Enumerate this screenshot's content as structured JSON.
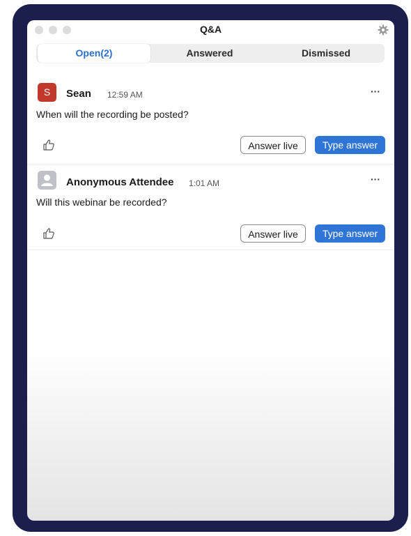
{
  "window": {
    "title": "Q&A"
  },
  "tabs": [
    {
      "label": "Open(2)",
      "active": true
    },
    {
      "label": "Answered",
      "active": false
    },
    {
      "label": "Dismissed",
      "active": false
    }
  ],
  "questions": [
    {
      "avatar_initial": "S",
      "avatar_color": "#c0392b",
      "name": "Sean",
      "time": "12:59 AM",
      "text": "When will the recording be posted?",
      "more": "···",
      "answer_live": "Answer live",
      "type_answer": "Type answer"
    },
    {
      "avatar_initial": "",
      "avatar_color": "#bfc0c8",
      "avatar_icon": "person-icon",
      "name": "Anonymous Attendee",
      "time": "1:01 AM",
      "text": "Will this webinar be recorded?",
      "more": "···",
      "answer_live": "Answer live",
      "type_answer": "Type answer"
    }
  ],
  "colors": {
    "frame": "#1c1f4e",
    "accent": "#2f75d6",
    "active_tab_text": "#2a6fc9"
  }
}
